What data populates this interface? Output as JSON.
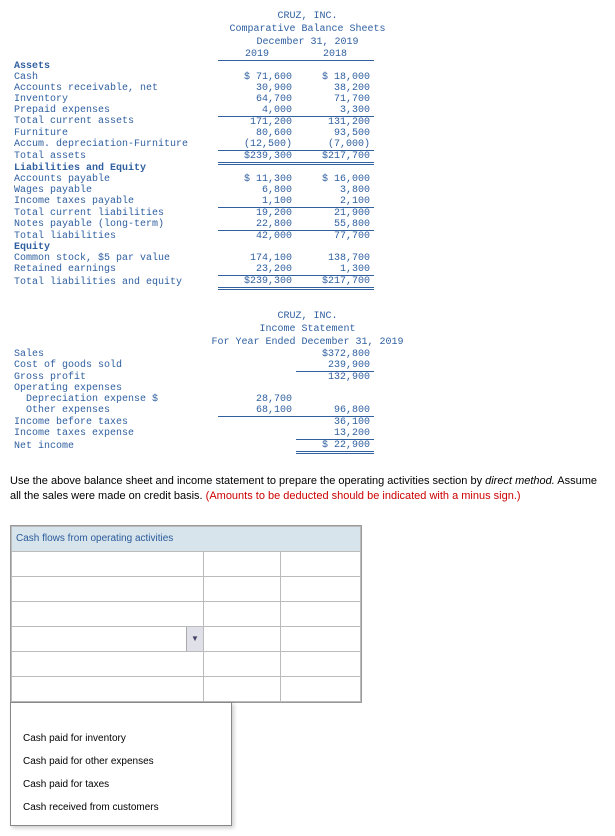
{
  "bs": {
    "company": "CRUZ, INC.",
    "title": "Comparative Balance Sheets",
    "date": "December 31, 2019",
    "col1": "2019",
    "col2": "2018",
    "assets_hdr": "Assets",
    "rows": {
      "cash": {
        "l": "Cash",
        "a": "$ 71,600",
        "b": "$ 18,000"
      },
      "ar": {
        "l": "Accounts receivable, net",
        "a": "30,900",
        "b": "38,200"
      },
      "inv": {
        "l": "Inventory",
        "a": "64,700",
        "b": "71,700"
      },
      "pre": {
        "l": "Prepaid expenses",
        "a": "4,000",
        "b": "3,300"
      },
      "tca": {
        "l": "Total current assets",
        "a": "171,200",
        "b": "131,200"
      },
      "furn": {
        "l": "Furniture",
        "a": "80,600",
        "b": "93,500"
      },
      "dep": {
        "l": "Accum. depreciation-Furniture",
        "a": "(12,500)",
        "b": "(7,000)"
      },
      "ta": {
        "l": "Total assets",
        "a": "$239,300",
        "b": "$217,700"
      }
    },
    "liab_hdr": "Liabilities and Equity",
    "lrows": {
      "ap": {
        "l": "Accounts payable",
        "a": "$ 11,300",
        "b": "$ 16,000"
      },
      "wp": {
        "l": "Wages payable",
        "a": "6,800",
        "b": "3,800"
      },
      "itp": {
        "l": "Income taxes payable",
        "a": "1,100",
        "b": "2,100"
      },
      "tcl": {
        "l": "Total current liabilities",
        "a": "19,200",
        "b": "21,900"
      },
      "np": {
        "l": "Notes payable (long-term)",
        "a": "22,800",
        "b": "55,800"
      },
      "tl": {
        "l": "Total liabilities",
        "a": "42,000",
        "b": "77,700"
      }
    },
    "eq_hdr": "Equity",
    "erows": {
      "cs": {
        "l": "Common stock, $5 par value",
        "a": "174,100",
        "b": "138,700"
      },
      "re": {
        "l": "Retained earnings",
        "a": "23,200",
        "b": "1,300"
      },
      "tle": {
        "l": "Total liabilities and equity",
        "a": "$239,300",
        "b": "$217,700"
      }
    }
  },
  "is": {
    "company": "CRUZ, INC.",
    "title": "Income Statement",
    "date": "For Year Ended December 31, 2019",
    "rows": {
      "sales": {
        "l": "Sales",
        "v": "$372,800"
      },
      "cogs": {
        "l": "Cost of goods sold",
        "v": "239,900"
      },
      "gp": {
        "l": "Gross profit",
        "v": "132,900"
      },
      "opex": {
        "l": "Operating expenses"
      },
      "depx": {
        "l": "Depreciation expense $",
        "a": "28,700"
      },
      "othx": {
        "l": "Other expenses",
        "a": "68,100",
        "v": "96,800"
      },
      "ibt": {
        "l": "Income before taxes",
        "v": "36,100"
      },
      "itx": {
        "l": "Income taxes expense",
        "v": "13,200"
      },
      "ni": {
        "l": "Net income",
        "v": "$ 22,900"
      }
    }
  },
  "instr": {
    "t1": "Use the above balance sheet and income statement to prepare the operating activities section by ",
    "t2": "direct method.",
    "t3": " Assume all the sales were made on credit basis. ",
    "t4": "(Amounts to be deducted should be indicated with a minus sign.)"
  },
  "answer": {
    "header": "Cash flows from operating activities"
  },
  "dropdown": {
    "opts": [
      "Cash paid for inventory",
      "Cash paid for other expenses",
      "Cash paid for taxes",
      "Cash received from customers"
    ]
  }
}
